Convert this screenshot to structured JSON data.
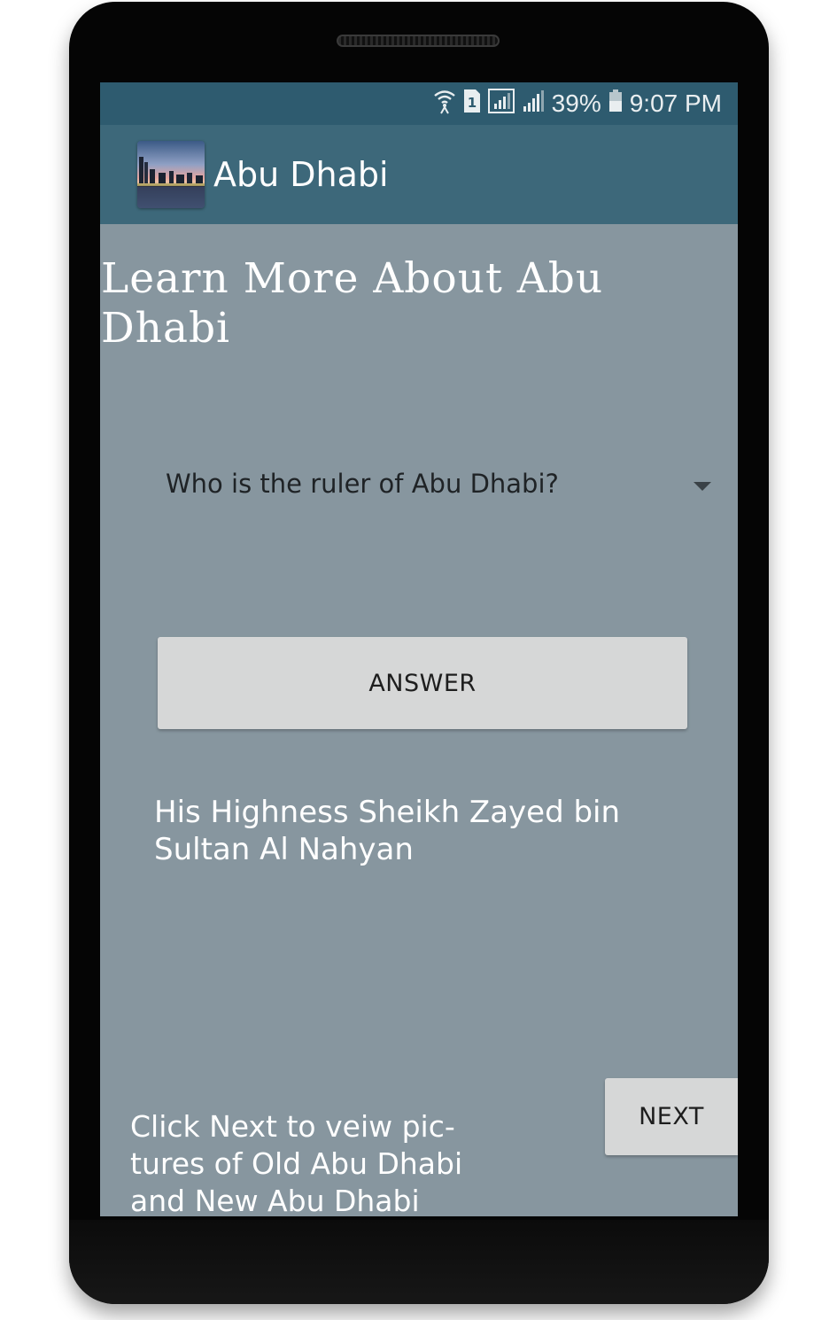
{
  "status_bar": {
    "battery_percent": "39%",
    "time": "9:07 PM",
    "sim_label": "1",
    "icons": [
      "wifi-icon",
      "sim-icon",
      "signal-icon",
      "signal-icon",
      "battery-icon"
    ]
  },
  "app_bar": {
    "title": "Abu Dhabi",
    "icon": "skyline-thumbnail"
  },
  "main": {
    "heading": "Learn More About Abu Dhabi",
    "question_selector": {
      "selected": "Who is the ruler of Abu Dhabi?"
    },
    "answer_button_label": "ANSWER",
    "answer_text": "His Highness Sheikh Zayed bin Sultan Al Nahyan",
    "footer_text": "Click Next to veiw pic-tures of Old Abu Dhabi and New Abu Dhabi",
    "next_button_label": "NEXT"
  },
  "colors": {
    "status_bar": "#2e5b6f",
    "app_bar": "#3d687a",
    "background": "#87969f",
    "button": "#d6d7d7"
  }
}
